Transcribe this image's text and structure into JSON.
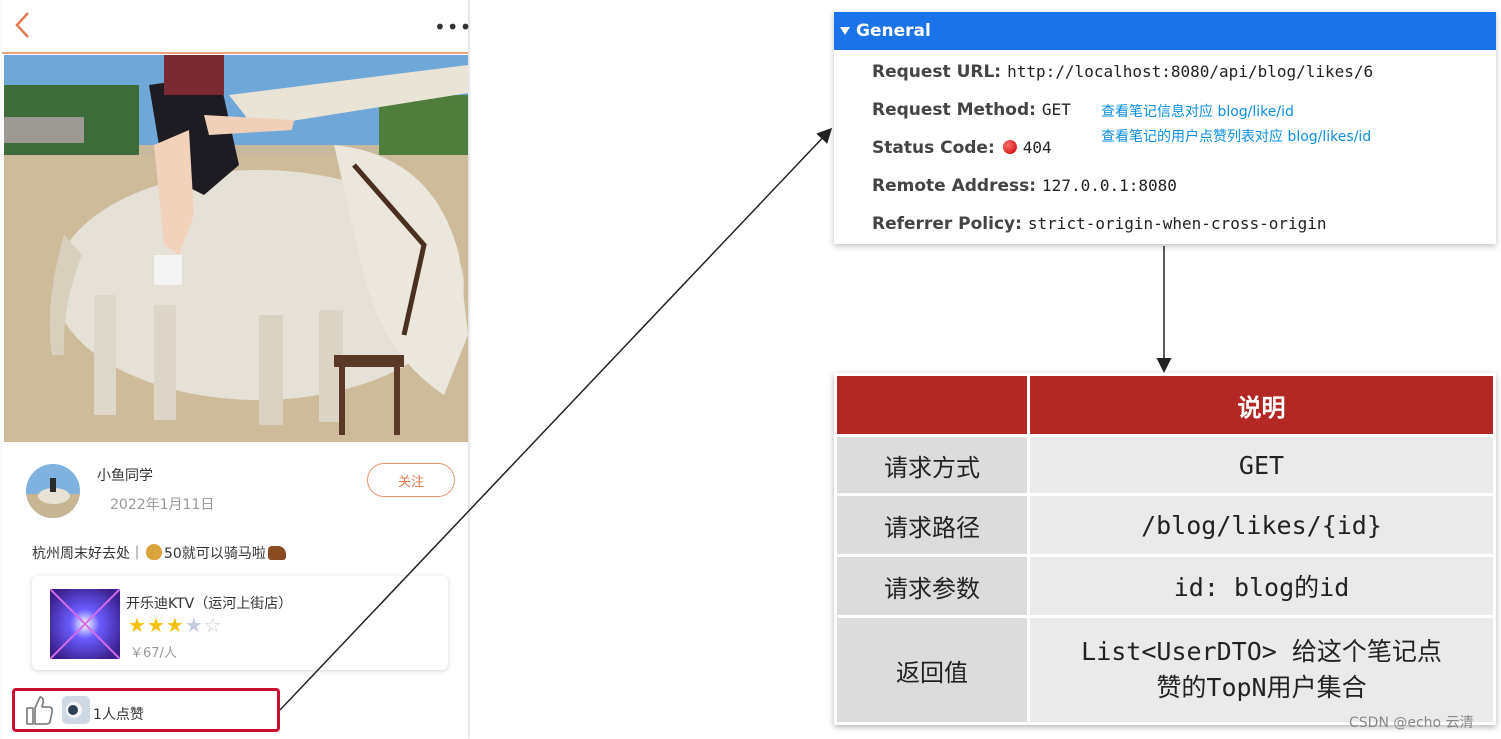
{
  "phone": {
    "author_name": "小鱼同学",
    "post_date": "2022年1月11日",
    "follow_label": "关注",
    "post_text_before": "杭州周末好去处｜",
    "post_text_after": "50就可以骑马啦",
    "shop": {
      "name": "开乐迪KTV（运河上街店）",
      "price": "￥67/人",
      "rating": 3,
      "max_rating": 5
    },
    "like_count_label": "1人点赞",
    "icons": [
      "back-chevron-icon",
      "more-dots-icon",
      "thumbs-up-icon",
      "moneybag-icon",
      "horse-icon"
    ]
  },
  "general_panel": {
    "title": "General",
    "rows": [
      {
        "key": "Request URL:",
        "value": "http://localhost:8080/api/blog/likes/6"
      },
      {
        "key": "Request Method:",
        "value": "GET"
      },
      {
        "key": "Status Code:",
        "value": "404"
      },
      {
        "key": "Remote Address:",
        "value": "127.0.0.1:8080"
      },
      {
        "key": "Referrer Policy:",
        "value": "strict-origin-when-cross-origin"
      }
    ],
    "notes": [
      "查看笔记信息对应 blog/like/id",
      "查看笔记的用户点赞列表对应 blog/likes/id"
    ]
  },
  "spec_table": {
    "header": [
      "",
      "说明"
    ],
    "rows": [
      {
        "key": "请求方式",
        "value": "GET"
      },
      {
        "key": "请求路径",
        "value": "/blog/likes/{id}"
      },
      {
        "key": "请求参数",
        "value": "id: blog的id"
      },
      {
        "key": "返回值",
        "value_line1": "List<UserDTO> 给这个笔记点",
        "value_line2": "赞的TopN用户集合"
      }
    ]
  },
  "watermark": "CSDN @echo 云清",
  "colors": {
    "accent_orange": "#e27d54",
    "devtools_blue": "#1a73e8",
    "table_header_red": "#b32825",
    "highlight_red": "#c8102e",
    "note_blue": "#0a8fe0"
  }
}
